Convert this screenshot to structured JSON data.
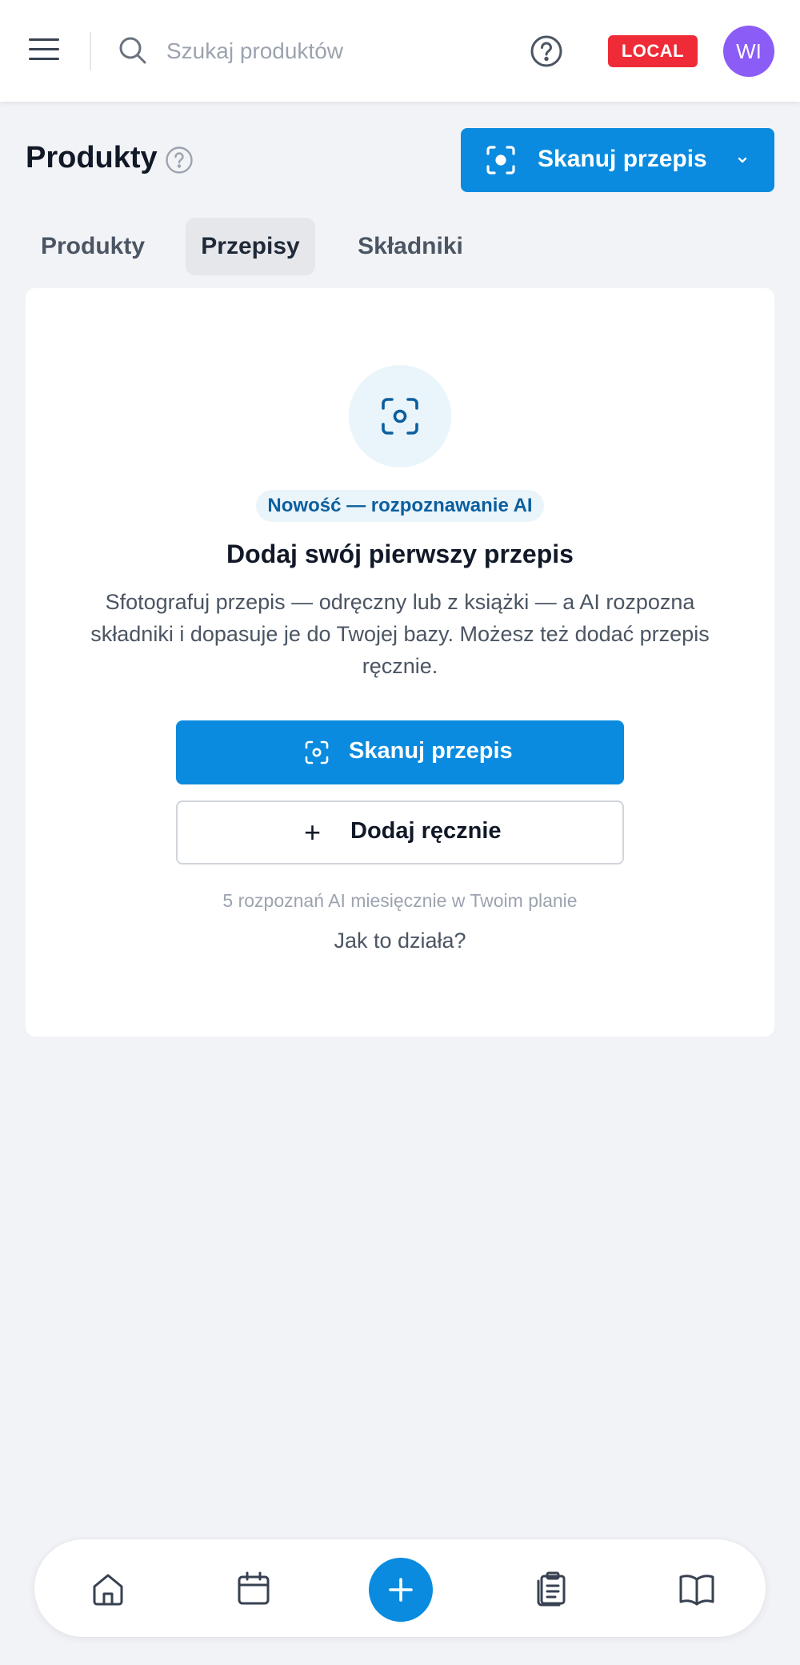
{
  "header": {
    "search_placeholder": "Szukaj produktów",
    "env_badge": "LOCAL",
    "avatar_initials": "WI"
  },
  "page": {
    "title": "Produkty",
    "scan_button_label": "Skanuj przepis"
  },
  "tabs": [
    {
      "label": "Produkty",
      "active": false
    },
    {
      "label": "Przepisy",
      "active": true
    },
    {
      "label": "Składniki",
      "active": false
    }
  ],
  "empty_state": {
    "badge": "Nowość — rozpoznawanie AI",
    "title": "Dodaj swój pierwszy przepis",
    "description": "Sfotografuj przepis — odręczny lub z książki — a AI rozpozna składniki i dopasuje je do Twojej bazy. Możesz też dodać przepis ręcznie.",
    "primary_button": "Skanuj przepis",
    "secondary_button": "Dodaj ręcznie",
    "quota_note": "5 rozpoznań AI miesięcznie w Twoim planie",
    "help_link": "Jak to działa?"
  },
  "bottom_nav": [
    "home-icon",
    "calendar-icon",
    "add-icon",
    "clipboard-list-icon",
    "book-icon"
  ],
  "colors": {
    "primary": "#0a8bdf",
    "badge_red": "#ef2b37",
    "avatar": "#8b5cf6",
    "background": "#f2f3f6"
  }
}
